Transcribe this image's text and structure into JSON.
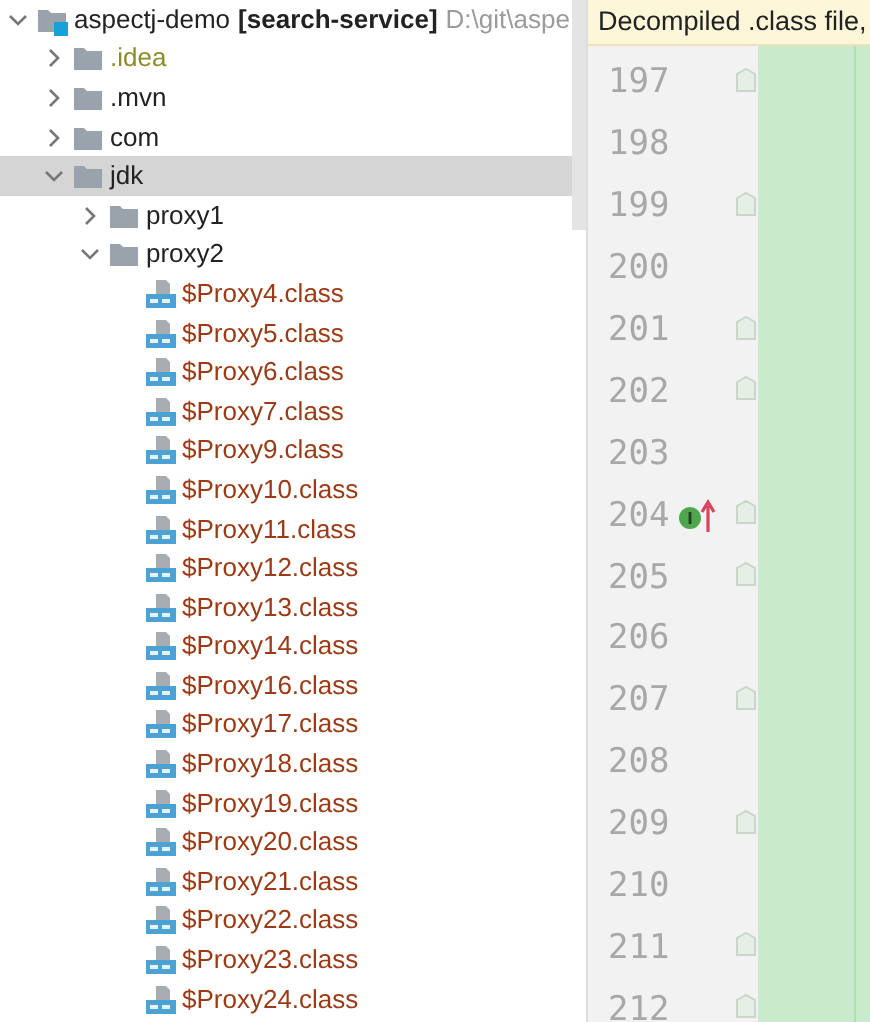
{
  "project_tree": {
    "root": {
      "label": "aspectj-demo",
      "module": "[search-service]",
      "path": "D:\\git\\aspe",
      "expanded": true,
      "selected": false
    },
    "items": [
      {
        "label": ".idea",
        "kind": "folder",
        "expanded": false,
        "selected": false,
        "color": "#8c8c2a"
      },
      {
        "label": ".mvn",
        "kind": "folder",
        "expanded": false,
        "selected": false,
        "color": "#222222"
      },
      {
        "label": "com",
        "kind": "folder",
        "expanded": false,
        "selected": false,
        "color": "#222222"
      },
      {
        "label": "jdk",
        "kind": "folder",
        "expanded": true,
        "selected": true,
        "color": "#222222",
        "children": [
          {
            "label": "proxy1",
            "kind": "folder",
            "expanded": false,
            "selected": false,
            "color": "#222222"
          },
          {
            "label": "proxy2",
            "kind": "folder",
            "expanded": true,
            "selected": false,
            "color": "#222222",
            "children": [
              {
                "label": "$Proxy4.class",
                "kind": "class",
                "selected": false,
                "color": "#9b3a14"
              },
              {
                "label": "$Proxy5.class",
                "kind": "class",
                "selected": false,
                "color": "#9b3a14"
              },
              {
                "label": "$Proxy6.class",
                "kind": "class",
                "selected": false,
                "color": "#9b3a14"
              },
              {
                "label": "$Proxy7.class",
                "kind": "class",
                "selected": false,
                "color": "#9b3a14"
              },
              {
                "label": "$Proxy9.class",
                "kind": "class",
                "selected": false,
                "color": "#9b3a14"
              },
              {
                "label": "$Proxy10.class",
                "kind": "class",
                "selected": false,
                "color": "#9b3a14"
              },
              {
                "label": "$Proxy11.class",
                "kind": "class",
                "selected": false,
                "color": "#9b3a14"
              },
              {
                "label": "$Proxy12.class",
                "kind": "class",
                "selected": false,
                "color": "#9b3a14"
              },
              {
                "label": "$Proxy13.class",
                "kind": "class",
                "selected": false,
                "color": "#9b3a14"
              },
              {
                "label": "$Proxy14.class",
                "kind": "class",
                "selected": false,
                "color": "#9b3a14"
              },
              {
                "label": "$Proxy16.class",
                "kind": "class",
                "selected": false,
                "color": "#9b3a14"
              },
              {
                "label": "$Proxy17.class",
                "kind": "class",
                "selected": false,
                "color": "#9b3a14"
              },
              {
                "label": "$Proxy18.class",
                "kind": "class",
                "selected": false,
                "color": "#9b3a14"
              },
              {
                "label": "$Proxy19.class",
                "kind": "class",
                "selected": false,
                "color": "#9b3a14"
              },
              {
                "label": "$Proxy20.class",
                "kind": "class",
                "selected": false,
                "color": "#9b3a14"
              },
              {
                "label": "$Proxy21.class",
                "kind": "class",
                "selected": false,
                "color": "#9b3a14"
              },
              {
                "label": "$Proxy22.class",
                "kind": "class",
                "selected": false,
                "color": "#9b3a14"
              },
              {
                "label": "$Proxy23.class",
                "kind": "class",
                "selected": false,
                "color": "#9b3a14"
              },
              {
                "label": "$Proxy24.class",
                "kind": "class",
                "selected": false,
                "color": "#9b3a14"
              }
            ]
          }
        ]
      }
    ]
  },
  "editor": {
    "banner": "Decompiled .class file,",
    "lines": [
      {
        "number": "197",
        "fold": true
      },
      {
        "number": "198",
        "fold": false
      },
      {
        "number": "199",
        "fold": true
      },
      {
        "number": "200",
        "fold": false
      },
      {
        "number": "201",
        "fold": true
      },
      {
        "number": "202",
        "fold": true
      },
      {
        "number": "203",
        "fold": false
      },
      {
        "number": "204",
        "fold": true,
        "implements_marker": true
      },
      {
        "number": "205",
        "fold": true
      },
      {
        "number": "206",
        "fold": false
      },
      {
        "number": "207",
        "fold": true
      },
      {
        "number": "208",
        "fold": false
      },
      {
        "number": "209",
        "fold": true
      },
      {
        "number": "210",
        "fold": false
      },
      {
        "number": "211",
        "fold": true
      },
      {
        "number": "212",
        "fold": true
      }
    ]
  }
}
